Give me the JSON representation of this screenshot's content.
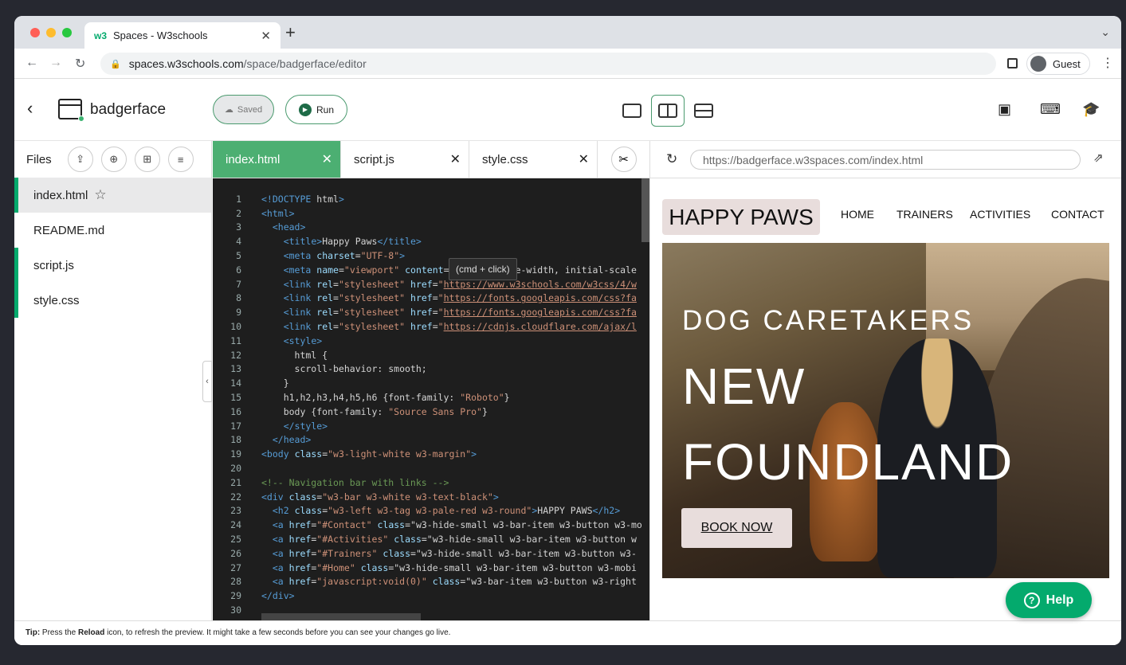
{
  "browser": {
    "tab_title": "Spaces - W3schools",
    "favicon": "w3",
    "url_domain": "spaces.w3schools.com",
    "url_path": "/space/badgerface/editor",
    "profile": "Guest"
  },
  "app": {
    "project": "badgerface",
    "saved": "Saved",
    "run": "Run"
  },
  "files": {
    "header": "Files",
    "items": [
      {
        "name": "index.html",
        "active": true,
        "marked": true
      },
      {
        "name": "README.md",
        "active": false,
        "marked": false
      },
      {
        "name": "script.js",
        "active": false,
        "marked": true
      },
      {
        "name": "style.css",
        "active": false,
        "marked": true
      }
    ]
  },
  "editor_tabs": [
    "index.html",
    "script.js",
    "style.css"
  ],
  "tooltip": "(cmd + click)",
  "code": [
    "<!DOCTYPE html>",
    "<html>",
    "  <head>",
    "    <title>Happy Paws</title>",
    "    <meta charset=\"UTF-8\">",
    "    <meta name=\"viewport\" content=\"width=device-width, initial-scale",
    "    <link rel=\"stylesheet\" href=\"https://www.w3schools.com/w3css/4/w",
    "    <link rel=\"stylesheet\" href=\"https://fonts.googleapis.com/css?fa",
    "    <link rel=\"stylesheet\" href=\"https://fonts.googleapis.com/css?fa",
    "    <link rel=\"stylesheet\" href=\"https://cdnjs.cloudflare.com/ajax/l",
    "    <style>",
    "      html {",
    "      scroll-behavior: smooth;",
    "    }",
    "    h1,h2,h3,h4,h5,h6 {font-family: \"Roboto\"}",
    "    body {font-family: \"Source Sans Pro\"}",
    "    </style>",
    "  </head>",
    "<body class=\"w3-light-white w3-margin\">",
    "",
    "<!-- Navigation bar with links -->",
    "<div class=\"w3-bar w3-white w3-text-black\">",
    "  <h2 class=\"w3-left w3-tag w3-pale-red w3-round\">HAPPY PAWS</h2>",
    "  <a href=\"#Contact\" class=\"w3-hide-small w3-bar-item w3-button w3-mo",
    "  <a href=\"#Activities\" class=\"w3-hide-small w3-bar-item w3-button w",
    "  <a href=\"#Trainers\" class=\"w3-hide-small w3-bar-item w3-button w3-",
    "  <a href=\"#Home\" class=\"w3-hide-small w3-bar-item w3-button w3-mobi",
    "  <a href=\"javascript:void(0)\" class=\"w3-bar-item w3-button w3-right",
    "</div>",
    ""
  ],
  "preview": {
    "url": "https://badgerface.w3spaces.com/index.html",
    "logo": "HAPPY PAWS",
    "nav": [
      "HOME",
      "TRAINERS",
      "ACTIVITIES",
      "CONTACT"
    ],
    "hero_line1": "DOG CARETAKERS",
    "hero_line2": "NEW",
    "hero_line3": "FOUNDLAND",
    "cta": "BOOK NOW"
  },
  "help": "Help",
  "footer": {
    "tip_label": "Tip:",
    "text_a": " Press the ",
    "reload": "Reload",
    "text_b": " icon, to refresh the preview. It might take a few seconds before you can see your changes go live."
  },
  "colors": {
    "accent": "#04aa6d",
    "tab_active": "#4caf72"
  },
  "icons": [
    "back-icon",
    "upload-icon",
    "new-file-icon",
    "new-folder-icon",
    "filter-icon",
    "cpu-icon",
    "keyboard-icon",
    "graduation-cap-icon",
    "scissors-icon",
    "reload-icon",
    "external-link-icon"
  ]
}
